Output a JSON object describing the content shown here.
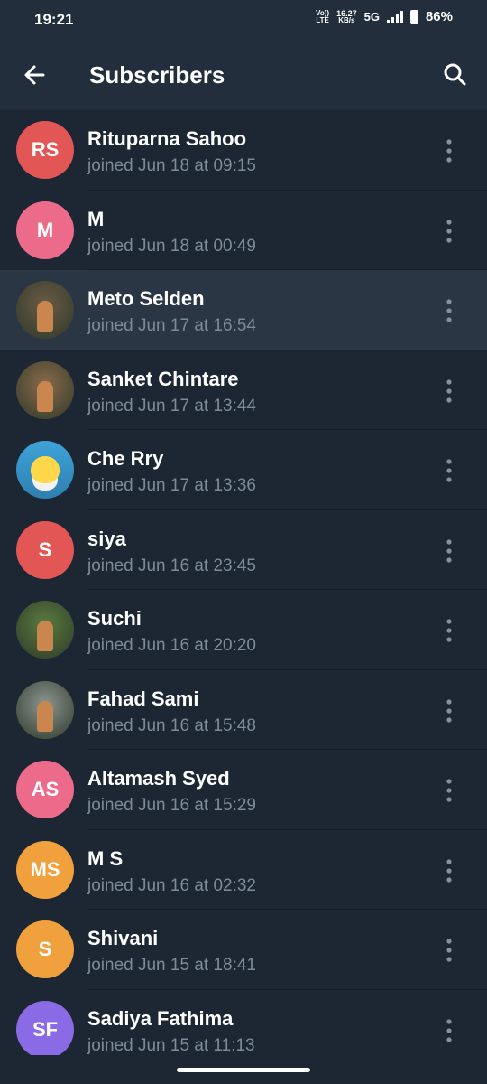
{
  "status_bar": {
    "time": "19:21",
    "volte_top": "Vo))",
    "volte_bottom": "LTE",
    "speed_top": "16.27",
    "speed_bottom": "KB/s",
    "network": "5G",
    "battery": "86%"
  },
  "header": {
    "title": "Subscribers",
    "back_icon": "back-arrow-icon",
    "search_icon": "search-icon"
  },
  "subscribers": [
    {
      "name": "Rituparna Sahoo",
      "joined": "joined Jun 18 at 09:15",
      "initials": "RS",
      "color": "#e35656"
    },
    {
      "name": "M",
      "joined": "joined Jun 18 at 00:49",
      "initials": "M",
      "color": "#ec6b8a"
    },
    {
      "name": "Meto Selden",
      "joined": "joined Jun 17 at 16:54",
      "initials": "",
      "color": "#6b5a45",
      "photo": true
    },
    {
      "name": "Sanket Chintare",
      "joined": "joined Jun 17 at 13:44",
      "initials": "",
      "color": "#8a6a4a",
      "photo": true
    },
    {
      "name": "Che Rry",
      "joined": "joined Jun 17 at 13:36",
      "initials": "",
      "color": "#3ea3d8",
      "emoji": true
    },
    {
      "name": "siya",
      "joined": "joined Jun 16 at 23:45",
      "initials": "S",
      "color": "#e35656"
    },
    {
      "name": "Suchi",
      "joined": "joined Jun 16 at 20:20",
      "initials": "",
      "color": "#5b7a3e",
      "photo": true
    },
    {
      "name": "Fahad Sami",
      "joined": "joined Jun 16 at 15:48",
      "initials": "",
      "color": "#8c9490",
      "photo": true
    },
    {
      "name": "Altamash Syed",
      "joined": "joined Jun 16 at 15:29",
      "initials": "AS",
      "color": "#ec6b8a"
    },
    {
      "name": "M S",
      "joined": "joined Jun 16 at 02:32",
      "initials": "MS",
      "color": "#f0a03c"
    },
    {
      "name": "Shivani",
      "joined": "joined Jun 15 at 18:41",
      "initials": "S",
      "color": "#f0a03c"
    },
    {
      "name": "Sadiya Fathima",
      "joined": "joined Jun 15 at 11:13",
      "initials": "SF",
      "color": "#8b6ae6"
    }
  ]
}
